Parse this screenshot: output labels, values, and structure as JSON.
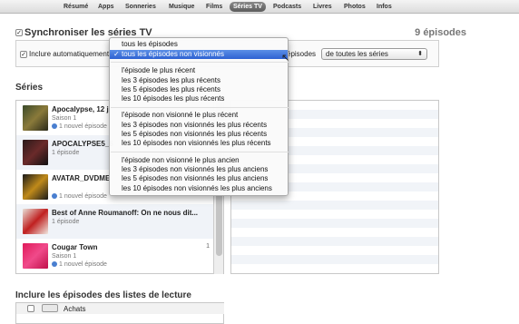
{
  "tabs": [
    "Résumé",
    "Apps",
    "Sonneries",
    "Musique",
    "Films",
    "Séries TV",
    "Podcasts",
    "Livres",
    "Photos",
    "Infos"
  ],
  "sync": {
    "title": "Synchroniser les séries TV",
    "count": "9 épisodes",
    "include_label": "Inclure automatiquement",
    "episodes_label": "épisodes",
    "series_select": "de toutes les séries"
  },
  "series": {
    "title": "Séries",
    "items": [
      {
        "title": "Apocalypse, 12 j",
        "season": "Saison 1",
        "status": "1 nouvel épisode",
        "count": ""
      },
      {
        "title": "APOCALYPSE5_6",
        "season": "",
        "status": "1 épisode",
        "count": ""
      },
      {
        "title": "AVATAR_DVDME",
        "season": "",
        "status": "1 nouvel épisode",
        "count": ""
      },
      {
        "title": "Best of Anne Roumanoff: On ne nous dit...",
        "season": "",
        "status": "1 épisode",
        "count": ""
      },
      {
        "title": "Cougar Town",
        "season": "Saison 1",
        "status": "1 nouvel épisode",
        "count": "1"
      }
    ]
  },
  "playlists": {
    "title": "Inclure les épisodes des listes de lecture",
    "items": [
      "Achats"
    ]
  },
  "menu": {
    "groups": [
      [
        "tous les épisodes",
        "tous les épisodes non visionnés"
      ],
      [
        "l'épisode le plus récent",
        "les 3 épisodes les plus récents",
        "les 5 épisodes les plus récents",
        "les 10 épisodes les plus récents"
      ],
      [
        "l'épisode non visionné le plus récent",
        "les 3 épisodes non visionnés les plus récents",
        "les 5 épisodes non visionnés les plus récents",
        "les 10 épisodes non visionnés les plus récents"
      ],
      [
        "l'épisode non visionné le plus ancien",
        "les 3 épisodes non visionnés les plus anciens",
        "les 5 épisodes non visionnés les plus anciens",
        "les 10 épisodes non visionnés les plus anciens"
      ]
    ],
    "selected": "tous les épisodes non visionnés",
    "checkmark": "✓"
  },
  "colors": {
    "selection": "#2e62d2",
    "new_dot": "#4a7fd0",
    "active_tab": "#5c5c5c"
  }
}
